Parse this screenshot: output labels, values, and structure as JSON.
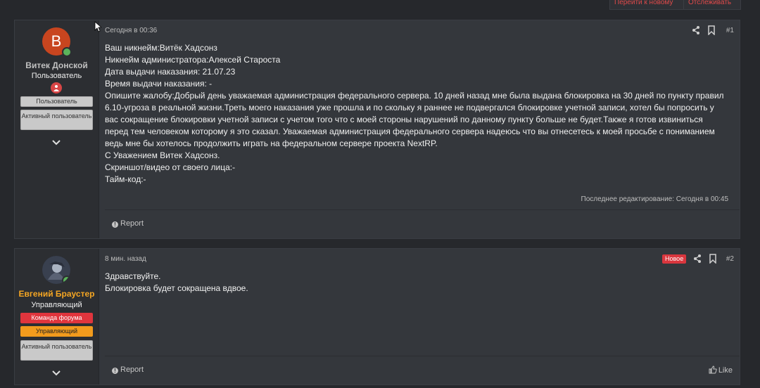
{
  "thread_actions": {
    "goto_new_label": "Перейти к новому",
    "watch_label": "Отслеживать"
  },
  "posts": [
    {
      "author": {
        "avatar_letter": "В",
        "name": "Витек Донской",
        "name_color": "#c0c0c0",
        "title": "Пользователь",
        "banners": [
          "Пользователь",
          "Активный пользователь"
        ]
      },
      "time": "Сегодня в 00:36",
      "number": "#1",
      "lines": [
        "Ваш никнейм:Витёк Хадсонз",
        "Никнейм администратора:Алексей Староста",
        "Дата выдачи наказания: 21.07.23",
        "Время выдачи наказания: -",
        "Опишите жалобу:Добрый день уважаемая администрация федерального сервера. 10 дней назад мне была выдана блокировка на 30 дней по пункту правил",
        "6.10-угроза в реальной жизни.Треть моего наказания уже прошла и по скольку я раннее не подвергался блокировке учетной записи, хотел бы попросить у",
        "вас сокращение блокировки учетной записи с учетом того что с моей стороны нарушений по данному пункту больше не будет.Также я готов извиниться",
        "перед тем человеком которому я это сказал. Уважаемая администрация федерального сервера надеюсь что вы отнесетесь к моей просьбе с пониманием",
        "ведь мне бы хотелось продолжить играть на федеральном сервере проекта NextRP.",
        "С Уважением Витек Хадсонз.",
        "Скриншот/видео от своего лица:-",
        "Тайм-код:-"
      ],
      "edited": "Последнее редактирование: Сегодня в 00:45",
      "report_label": "Report"
    },
    {
      "author": {
        "name": "Евгений Браустер",
        "name_color": "#f5a623",
        "title": "Управляющий",
        "banners": [
          "Команда форума",
          "Управляющий",
          "Активный пользователь"
        ]
      },
      "time": "8 мин. назад",
      "new_badge": "Новое",
      "number": "#2",
      "lines": [
        "Здравствуйте.",
        "Блокировка будет сокращена вдвое."
      ],
      "report_label": "Report",
      "like_label": "Like"
    }
  ],
  "icons": [
    "share-icon",
    "bookmark-icon",
    "chevron-down-icon",
    "report-icon",
    "like-icon",
    "user-badge-icon",
    "cursor-icon"
  ]
}
